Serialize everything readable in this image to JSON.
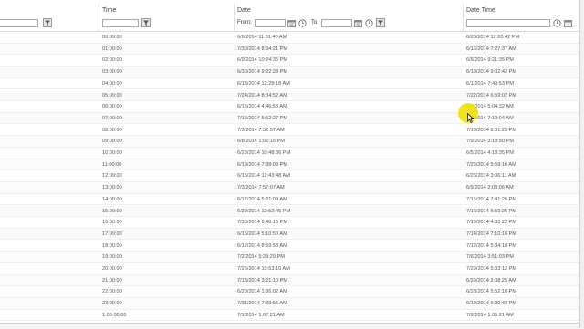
{
  "columns": {
    "time": "Time",
    "date": "Date",
    "datetime": "Date Time"
  },
  "filters": {
    "from_label": "From:",
    "to_label": "To:",
    "time_value": "",
    "from_value": "",
    "to_value": "",
    "datetime_value": ""
  },
  "icons": {
    "filter": "filter-icon",
    "calendar": "calendar-icon",
    "clock": "clock-icon"
  },
  "rows": [
    {
      "time": "00:00:00",
      "date": "6/6/2014 11:51:40 AM",
      "datetime": "6/20/2014 12:20:42 PM"
    },
    {
      "time": "01:00:00",
      "date": "7/30/2014 8:34:21 PM",
      "datetime": "6/16/2014 7:27:37 AM"
    },
    {
      "time": "02:00:00",
      "date": "6/9/2014 10:24:35 PM",
      "datetime": "6/9/2014 9:21:35 PM"
    },
    {
      "time": "03:00:00",
      "date": "6/30/2014 9:22:28 PM",
      "datetime": "6/18/2014 9:02:42 PM"
    },
    {
      "time": "04:00:00",
      "date": "6/13/2014 12:28:18 AM",
      "datetime": "6/1/2014 7:49:53 PM"
    },
    {
      "time": "05:00:00",
      "date": "7/24/2014 8:04:52 AM",
      "datetime": "7/22/2014 6:59:02 PM"
    },
    {
      "time": "06:00:00",
      "date": "6/15/2014 4:46:53 AM",
      "datetime": "6/4/2014 5:04:32 AM"
    },
    {
      "time": "07:00:00",
      "date": "7/15/2014 5:52:27 PM",
      "datetime": "7/3/2014 7:10:04 AM"
    },
    {
      "time": "08:00:00",
      "date": "7/3/2014 7:52:57 AM",
      "datetime": "7/18/2014 8:51:25 PM"
    },
    {
      "time": "09:00:00",
      "date": "6/8/2014 1:02:15 PM",
      "datetime": "7/9/2014 3:18:50 PM"
    },
    {
      "time": "10:00:00",
      "date": "6/28/2014 10:48:36 PM",
      "datetime": "6/5/2014 4:18:35 PM"
    },
    {
      "time": "11:00:00",
      "date": "6/19/2014 7:38:09 PM",
      "datetime": "7/25/2014 5:59:16 AM"
    },
    {
      "time": "12:00:00",
      "date": "6/15/2014 12:43:48 AM",
      "datetime": "6/26/2014 3:06:11 AM"
    },
    {
      "time": "13:00:00",
      "date": "7/3/2014 7:57:07 AM",
      "datetime": "6/9/2014 2:08:06 AM"
    },
    {
      "time": "14:00:00",
      "date": "6/17/2014 5:21:09 AM",
      "datetime": "7/15/2014 7:41:26 PM"
    },
    {
      "time": "15:00:00",
      "date": "6/29/2014 12:52:45 PM",
      "datetime": "7/16/2014 6:59:25 PM"
    },
    {
      "time": "16:00:00",
      "date": "7/30/2014 6:48:15 PM",
      "datetime": "7/16/2014 4:33:22 PM"
    },
    {
      "time": "17:00:00",
      "date": "6/15/2014 5:10:50 AM",
      "datetime": "7/14/2014 7:10:16 PM"
    },
    {
      "time": "18:00:00",
      "date": "6/12/2014 8:59:53 AM",
      "datetime": "7/12/2014 5:34:18 PM"
    },
    {
      "time": "19:00:00",
      "date": "7/2/2014 5:29:29 PM",
      "datetime": "7/6/2014 3:51:03 PM"
    },
    {
      "time": "20:00:00",
      "date": "7/25/2014 10:53:10 AM",
      "datetime": "7/29/2014 5:33:12 PM"
    },
    {
      "time": "21:00:00",
      "date": "7/13/2014 3:21:10 PM",
      "datetime": "6/29/2014 2:08:25 AM"
    },
    {
      "time": "22:00:00",
      "date": "6/20/2014 1:36:02 AM",
      "datetime": "6/28/2014 5:52:18 PM"
    },
    {
      "time": "23:00:00",
      "date": "7/31/2014 7:39:56 AM",
      "datetime": "6/13/2014 6:30:49 PM"
    },
    {
      "time": "1.00:00:00",
      "date": "7/1/2014 1:07:21 AM",
      "datetime": "7/9/2014 1:05:21 AM"
    }
  ]
}
